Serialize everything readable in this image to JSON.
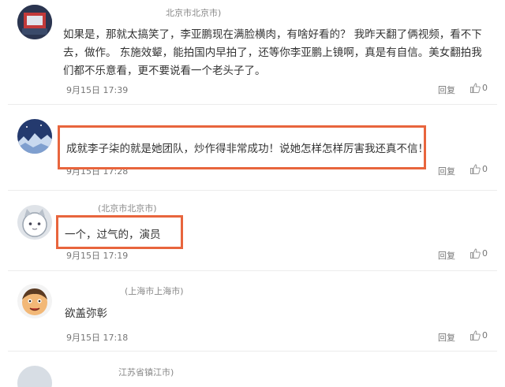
{
  "comments": [
    {
      "location": "北京市北京市)",
      "text": "如果是，那就太搞笑了，李亚鹏现在满脸横肉，有啥好看的？ 我昨天翻了俩视频，看不下去，做作。 东施效颦，能拍国内早拍了，还等你李亚鹏上镜啊，真是有自信。美女翻拍我们都不乐意看，更不要说看一个老头子了。",
      "time": "9月15日 17:39",
      "reply": "回复",
      "likes": "0"
    },
    {
      "location": "",
      "text": "成就李子柒的就是她团队，炒作得非常成功！说她怎样怎样厉害我还真不信！",
      "time": "9月15日 17:28",
      "reply": "回复",
      "likes": "0"
    },
    {
      "location": "(北京市北京市)",
      "text": "一个，过气的，演员",
      "time": "9月15日 17:19",
      "reply": "回复",
      "likes": "0"
    },
    {
      "location": "(上海市上海市)",
      "text": "欲盖弥彰",
      "time": "9月15日 17:18",
      "reply": "回复",
      "likes": "0"
    },
    {
      "location": "江苏省镇江市)"
    }
  ],
  "colors": {
    "highlight": "#e8653d",
    "separator": "#ececec",
    "meta": "#777777"
  }
}
